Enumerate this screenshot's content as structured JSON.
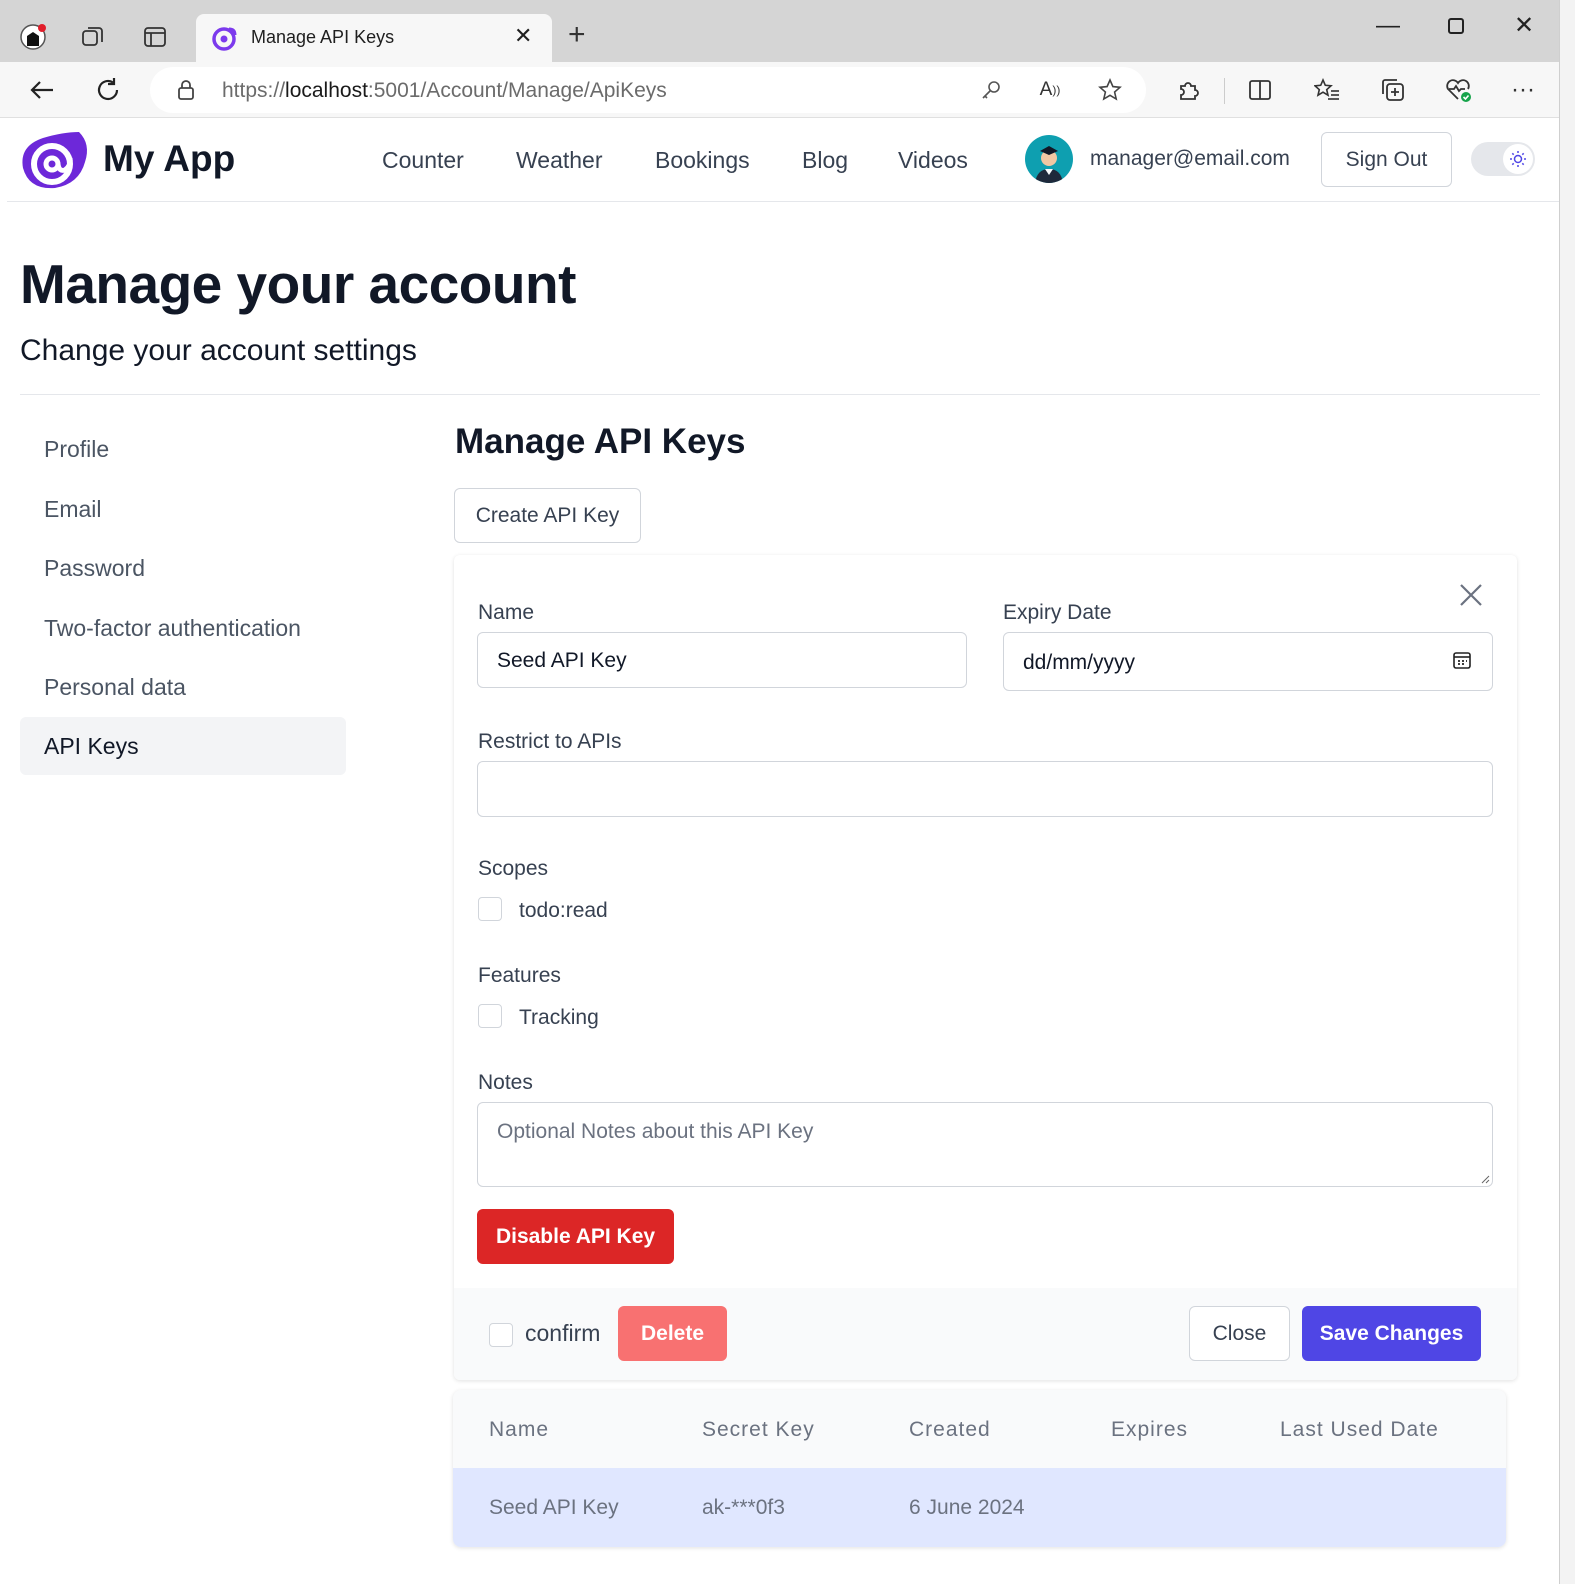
{
  "browser": {
    "tab_title": "Manage API Keys",
    "url_scheme": "https://",
    "url_host": "localhost",
    "url_rest": ":5001/Account/Manage/ApiKeys"
  },
  "header": {
    "brand": "My App",
    "nav": [
      "Counter",
      "Weather",
      "Bookings",
      "Blog",
      "Videos"
    ],
    "user_email": "manager@email.com",
    "sign_out": "Sign Out"
  },
  "page": {
    "title": "Manage your account",
    "subtitle": "Change your account settings"
  },
  "sidebar": {
    "items": [
      {
        "label": "Profile",
        "active": false
      },
      {
        "label": "Email",
        "active": false
      },
      {
        "label": "Password",
        "active": false
      },
      {
        "label": "Two-factor authentication",
        "active": false
      },
      {
        "label": "Personal data",
        "active": false
      },
      {
        "label": "API Keys",
        "active": true
      }
    ]
  },
  "api_keys": {
    "title": "Manage API Keys",
    "create_button": "Create API Key",
    "form": {
      "name_label": "Name",
      "name_value": "Seed API Key",
      "expiry_label": "Expiry Date",
      "expiry_placeholder": "dd/mm/yyyy",
      "restrict_label": "Restrict to APIs",
      "restrict_value": "",
      "scopes_label": "Scopes",
      "scope_option": "todo:read",
      "features_label": "Features",
      "feature_option": "Tracking",
      "notes_label": "Notes",
      "notes_placeholder": "Optional Notes about this API Key",
      "disable_button": "Disable API Key",
      "confirm_label": "confirm",
      "delete_button": "Delete",
      "close_button": "Close",
      "save_button": "Save Changes"
    },
    "table": {
      "headers": [
        "Name",
        "Secret Key",
        "Created",
        "Expires",
        "Last Used Date"
      ],
      "rows": [
        {
          "name": "Seed API Key",
          "secret": "ak-***0f3",
          "created": "6 June 2024",
          "expires": "",
          "last_used": ""
        }
      ]
    }
  },
  "colors": {
    "primary": "#4f46e5",
    "danger": "#dc2626",
    "danger_light": "#f87171",
    "selected_row": "#e0e7ff",
    "brand_purple": "#7c3aed"
  }
}
